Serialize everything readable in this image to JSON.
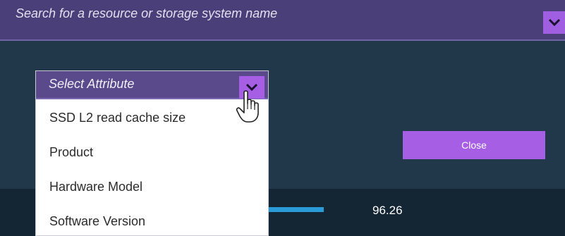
{
  "search": {
    "placeholder": "Search for a resource or storage system name",
    "chevron_icon": "chevron-down-icon"
  },
  "attribute_dropdown": {
    "selected_label": "Select Attribute",
    "chevron_icon": "chevron-down-icon",
    "options": [
      "SSD L2 read cache size",
      "Product",
      "Hardware Model",
      "Software Version"
    ]
  },
  "close_button": {
    "label": "Close"
  },
  "metric": {
    "value": "96.26"
  },
  "cursor": {
    "icon": "hand-pointer-icon"
  },
  "colors": {
    "search_bar_bg": "#4a3f78",
    "accent_purple": "#a55ee4",
    "panel_bg": "#21374a",
    "bottom_strip_bg": "#142534",
    "progress_blue": "#2a9bd6",
    "select_header_bg": "#5a4a8c"
  }
}
